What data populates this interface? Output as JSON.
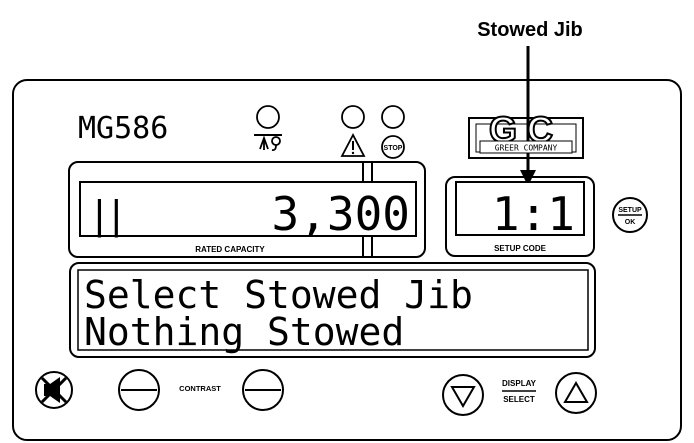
{
  "callout": {
    "label": "Stowed Jib"
  },
  "panel": {
    "model": "MG586",
    "brand": {
      "letters": "GC",
      "name": "GREER COMPANY"
    },
    "warning_lamps": [
      {
        "icon": "anti-two-block-icon",
        "text": ""
      },
      {
        "icon": "warning-triangle-icon",
        "text": ""
      },
      {
        "icon": "stop-icon",
        "text": "STOP"
      }
    ],
    "capacity_display": {
      "value": "3,300",
      "bar": "||",
      "label": "RATED CAPACITY"
    },
    "setup_display": {
      "value": "1:1",
      "label": "SETUP CODE"
    },
    "setup_button": {
      "top": "SETUP",
      "bottom": "OK"
    },
    "message_display": {
      "line1": "Select Stowed Jib",
      "line2": "Nothing Stowed"
    },
    "buttons": {
      "mute_icon": "horn-muted-icon",
      "contrast_label": "CONTRAST",
      "display_top": "DISPLAY",
      "display_bottom": "SELECT"
    }
  }
}
